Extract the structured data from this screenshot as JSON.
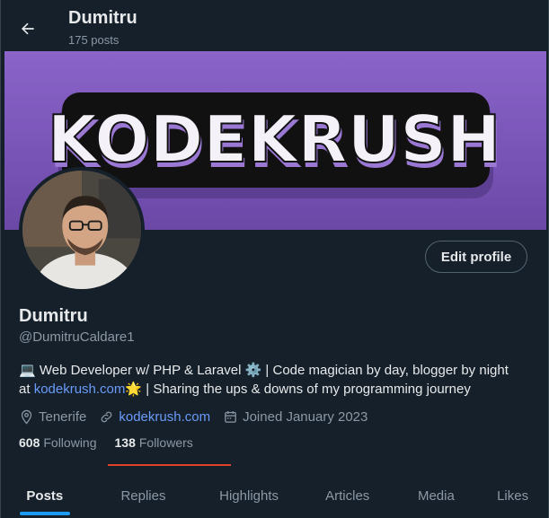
{
  "header": {
    "name": "Dumitru",
    "post_count": "175 posts",
    "back_icon": "arrow-left-icon"
  },
  "banner": {
    "text": "KODEKRUSH",
    "background_color": "#8a64c8"
  },
  "profile": {
    "display_name": "Dumitru",
    "handle": "@DumitruCaldare1",
    "edit_button": "Edit profile",
    "bio": {
      "line1_emoji": "💻",
      "line1_text": " Web Developer w/ PHP & Laravel ",
      "line1_gear": "⚙️",
      "line1_rest": " | Code magician by day, blogger by night",
      "line2_prefix": "at ",
      "line2_link": "kodekrush.com",
      "line2_emoji": "🌟",
      "line2_rest": " | Sharing the ups & downs of my programming journey"
    },
    "location": "Tenerife",
    "website": "kodekrush.com",
    "joined": "Joined January 2023"
  },
  "stats": {
    "following_count": "608",
    "following_label": "Following",
    "followers_count": "138",
    "followers_label": "Followers"
  },
  "tabs": [
    {
      "label": "Posts",
      "active": true
    },
    {
      "label": "Replies",
      "active": false
    },
    {
      "label": "Highlights",
      "active": false
    },
    {
      "label": "Articles",
      "active": false
    },
    {
      "label": "Media",
      "active": false
    },
    {
      "label": "Likes",
      "active": false
    }
  ],
  "colors": {
    "background": "#15202b",
    "accent": "#1d9bf0",
    "link": "#6a9bf8",
    "muted": "#8b98a5",
    "annotation_line": "#e04428"
  }
}
